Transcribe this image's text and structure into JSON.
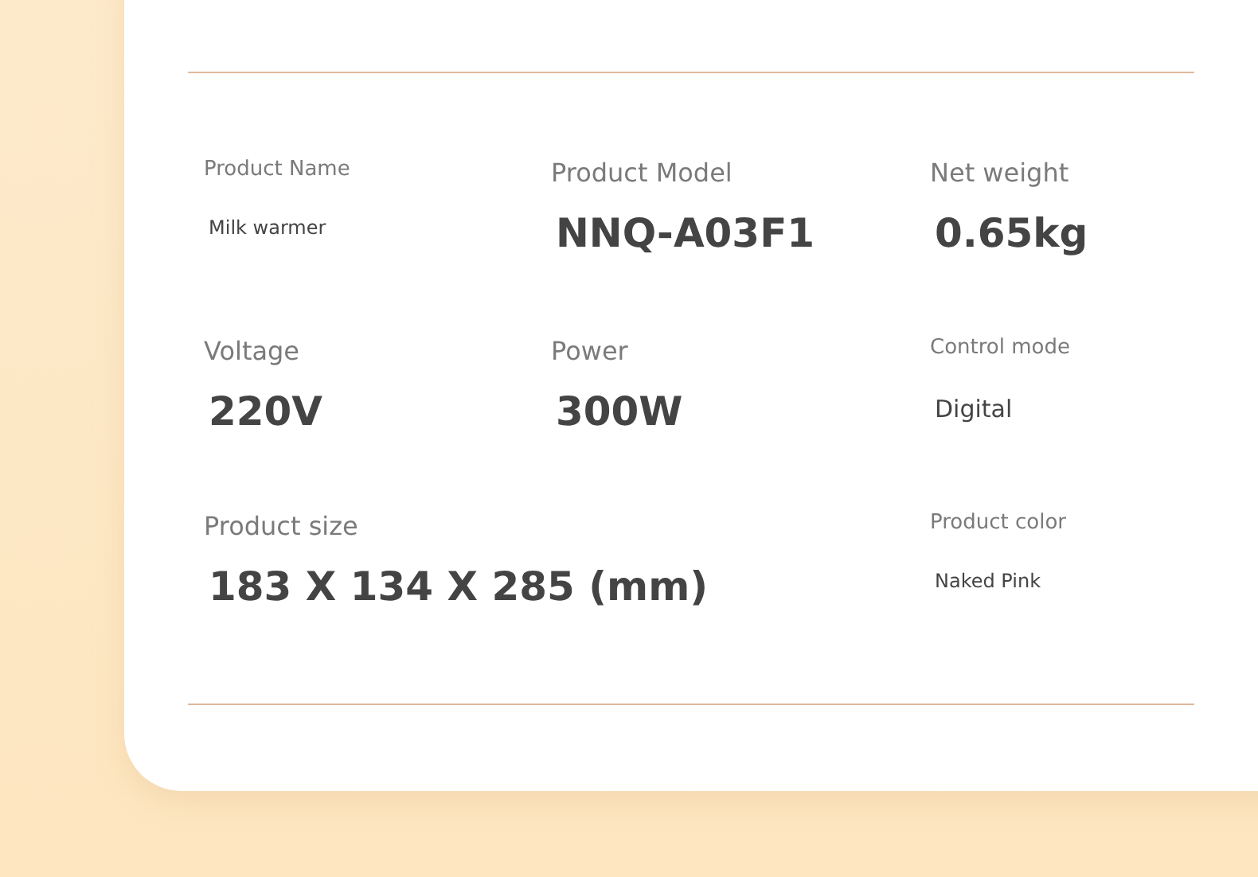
{
  "specs": [
    {
      "label": "Product Name",
      "value": "Milk warmer",
      "kind": "small"
    },
    {
      "label": "Product Model",
      "value": "NNQ-A03F1",
      "kind": "large"
    },
    {
      "label": "Net weight",
      "value": "0.65kg",
      "kind": "large"
    },
    {
      "label": "Voltage",
      "value": "220V",
      "kind": "large"
    },
    {
      "label": "Power",
      "value": "300W",
      "kind": "large"
    },
    {
      "label": "Control mode",
      "value": "Digital",
      "kind": "medium"
    },
    {
      "label": "Product size",
      "value": "183 X 134 X 285 (mm)",
      "kind": "wide"
    },
    {
      "label": "Product color",
      "value": "Naked Pink",
      "kind": "small"
    }
  ]
}
